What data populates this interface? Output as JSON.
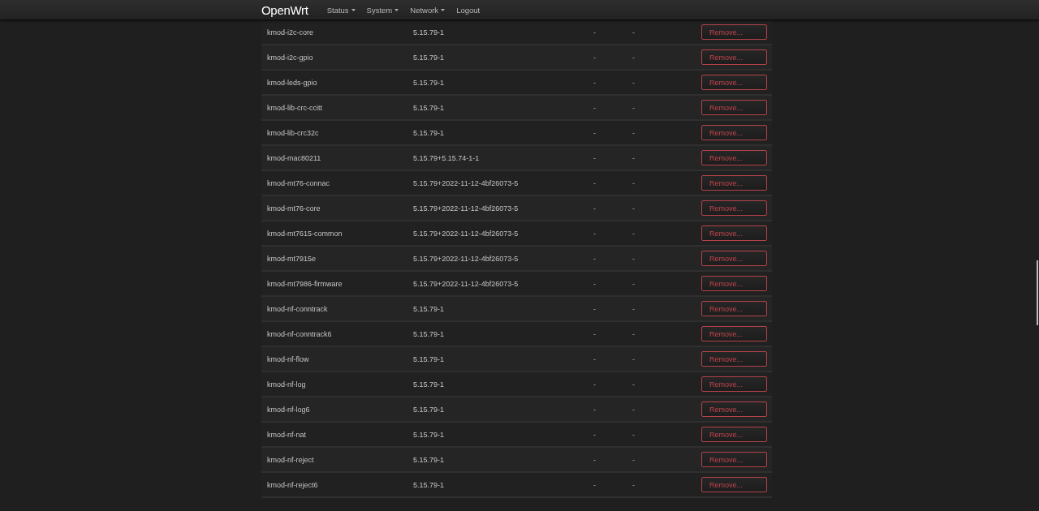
{
  "navbar": {
    "brand": "OpenWrt",
    "menu": [
      {
        "label": "Status",
        "dropdown": true
      },
      {
        "label": "System",
        "dropdown": true
      },
      {
        "label": "Network",
        "dropdown": true
      },
      {
        "label": "Logout",
        "dropdown": false
      }
    ]
  },
  "packages": [
    {
      "name": "kmod-i2c-core",
      "version": "5.15.79-1",
      "column_3": "-",
      "column_4": "-",
      "action": "Remove..."
    },
    {
      "name": "kmod-i2c-gpio",
      "version": "5.15.79-1",
      "column_3": "-",
      "column_4": "-",
      "action": "Remove..."
    },
    {
      "name": "kmod-leds-gpio",
      "version": "5.15.79-1",
      "column_3": "-",
      "column_4": "-",
      "action": "Remove..."
    },
    {
      "name": "kmod-lib-crc-ccitt",
      "version": "5.15.79-1",
      "column_3": "-",
      "column_4": "-",
      "action": "Remove..."
    },
    {
      "name": "kmod-lib-crc32c",
      "version": "5.15.79-1",
      "column_3": "-",
      "column_4": "-",
      "action": "Remove..."
    },
    {
      "name": "kmod-mac80211",
      "version": "5.15.79+5.15.74-1-1",
      "column_3": "-",
      "column_4": "-",
      "action": "Remove..."
    },
    {
      "name": "kmod-mt76-connac",
      "version": "5.15.79+2022-11-12-4bf26073-5",
      "column_3": "-",
      "column_4": "-",
      "action": "Remove..."
    },
    {
      "name": "kmod-mt76-core",
      "version": "5.15.79+2022-11-12-4bf26073-5",
      "column_3": "-",
      "column_4": "-",
      "action": "Remove..."
    },
    {
      "name": "kmod-mt7615-common",
      "version": "5.15.79+2022-11-12-4bf26073-5",
      "column_3": "-",
      "column_4": "-",
      "action": "Remove..."
    },
    {
      "name": "kmod-mt7915e",
      "version": "5.15.79+2022-11-12-4bf26073-5",
      "column_3": "-",
      "column_4": "-",
      "action": "Remove..."
    },
    {
      "name": "kmod-mt7986-firmware",
      "version": "5.15.79+2022-11-12-4bf26073-5",
      "column_3": "-",
      "column_4": "-",
      "action": "Remove..."
    },
    {
      "name": "kmod-nf-conntrack",
      "version": "5.15.79-1",
      "column_3": "-",
      "column_4": "-",
      "action": "Remove..."
    },
    {
      "name": "kmod-nf-conntrack6",
      "version": "5.15.79-1",
      "column_3": "-",
      "column_4": "-",
      "action": "Remove..."
    },
    {
      "name": "kmod-nf-flow",
      "version": "5.15.79-1",
      "column_3": "-",
      "column_4": "-",
      "action": "Remove..."
    },
    {
      "name": "kmod-nf-log",
      "version": "5.15.79-1",
      "column_3": "-",
      "column_4": "-",
      "action": "Remove..."
    },
    {
      "name": "kmod-nf-log6",
      "version": "5.15.79-1",
      "column_3": "-",
      "column_4": "-",
      "action": "Remove..."
    },
    {
      "name": "kmod-nf-nat",
      "version": "5.15.79-1",
      "column_3": "-",
      "column_4": "-",
      "action": "Remove..."
    },
    {
      "name": "kmod-nf-reject",
      "version": "5.15.79-1",
      "column_3": "-",
      "column_4": "-",
      "action": "Remove..."
    },
    {
      "name": "kmod-nf-reject6",
      "version": "5.15.79-1",
      "column_3": "-",
      "column_4": "-",
      "action": "Remove..."
    }
  ]
}
